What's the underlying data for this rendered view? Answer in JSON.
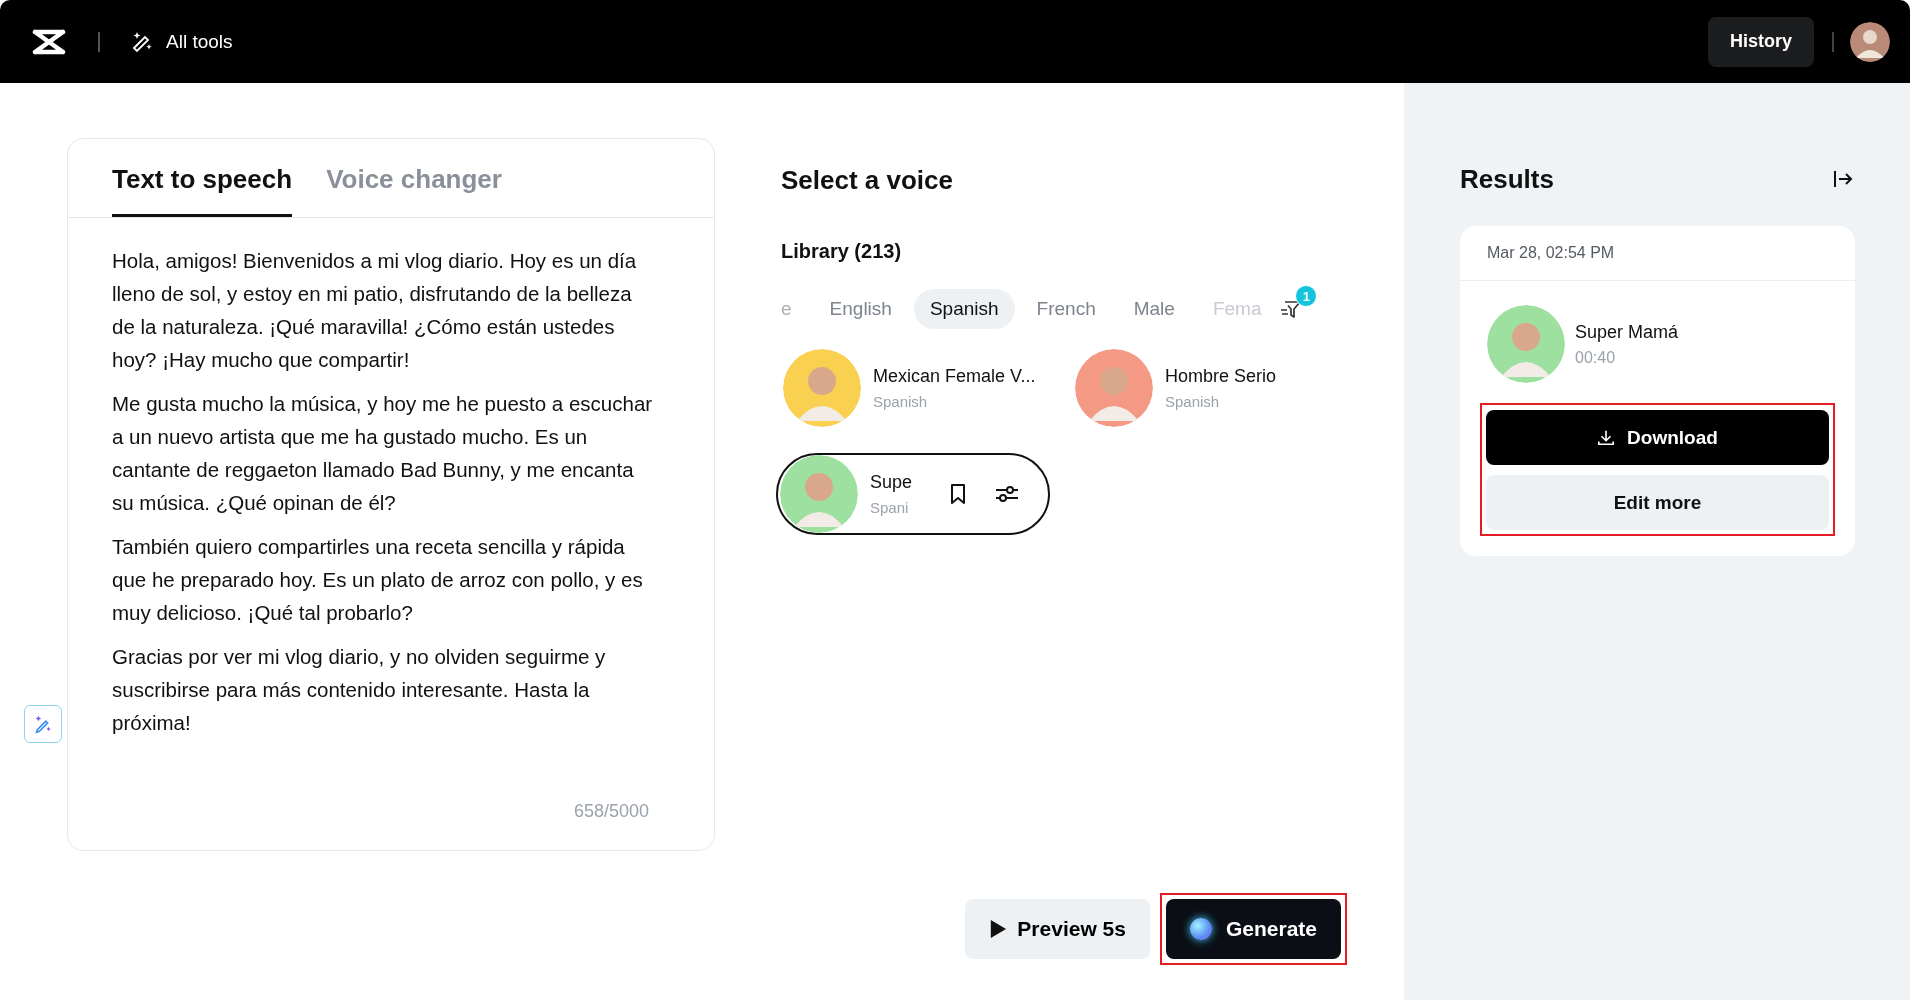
{
  "top_bar": {
    "all_tools": "All tools",
    "history": "History"
  },
  "editor": {
    "tabs": [
      {
        "label": "Text to speech",
        "selected": true
      },
      {
        "label": "Voice changer",
        "selected": false
      }
    ],
    "paragraphs": [
      "Hola, amigos! Bienvenidos a mi vlog diario. Hoy es un día lleno de sol, y estoy en mi patio, disfrutando de la belleza de la naturaleza. ¡Qué maravilla! ¿Cómo están ustedes hoy? ¡Hay mucho que compartir!",
      "Me gusta mucho la música, y hoy me he puesto a escuchar a un nuevo artista que me ha gustado mucho. Es un cantante de reggaeton llamado Bad Bunny, y me encanta su música. ¿Qué opinan de él?",
      "También quiero compartirles una receta sencilla y rápida que he preparado hoy. Es un plato de arroz con pollo, y es muy delicioso. ¡Qué tal probarlo?",
      "Gracias por ver mi vlog diario, y no olviden seguirme y suscribirse para más contenido interesante. Hasta la próxima!"
    ],
    "counter": "658/5000"
  },
  "voice_panel": {
    "title": "Select a voice",
    "library": "Library (213)",
    "filters": [
      {
        "label": "e",
        "selected": false
      },
      {
        "label": "English",
        "selected": false
      },
      {
        "label": "Spanish",
        "selected": true
      },
      {
        "label": "French",
        "selected": false
      },
      {
        "label": "Male",
        "selected": false
      },
      {
        "label": "Fema",
        "selected": false
      }
    ],
    "filter_badge": "1",
    "voices": [
      {
        "name": "Mexican Female V...",
        "language": "Spanish",
        "color": "#f9d04f",
        "selected": false
      },
      {
        "name": "Hombre Serio",
        "language": "Spanish",
        "color": "#f49a84",
        "selected": false
      },
      {
        "name": "Supe",
        "language": "Spani",
        "color": "#9ee0a0",
        "selected": true
      }
    ]
  },
  "actions": {
    "preview": "Preview 5s",
    "generate": "Generate"
  },
  "results": {
    "title": "Results",
    "items": [
      {
        "date": "Mar 28, 02:54 PM",
        "name": "Super Mamá",
        "duration": "00:40",
        "color": "#9ee0a0",
        "download": "Download",
        "edit": "Edit more"
      }
    ]
  }
}
